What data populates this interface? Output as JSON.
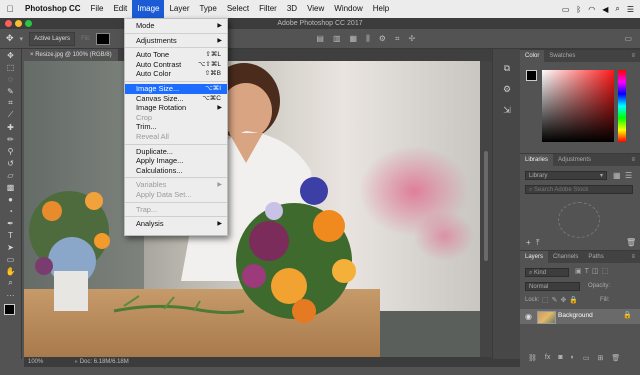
{
  "menubar": {
    "app": "Photoshop CC",
    "items": [
      "File",
      "Edit",
      "Image",
      "Layer",
      "Type",
      "Select",
      "Filter",
      "3D",
      "View",
      "Window",
      "Help"
    ],
    "active": "Image"
  },
  "window_title": "Adobe Photoshop CC 2017",
  "options_bar": {
    "sample_label": "Active Layers",
    "fill_label": "Fill:"
  },
  "document_tab": "Resize.jpg @ 100% (RGB/8)",
  "status": {
    "zoom": "100%",
    "doc": "Doc: 6.18M/6.18M"
  },
  "image_menu": {
    "items": [
      {
        "label": "Mode",
        "submenu": true
      },
      {
        "sep": true
      },
      {
        "label": "Adjustments",
        "submenu": true
      },
      {
        "sep": true
      },
      {
        "label": "Auto Tone",
        "shortcut": "⇧⌘L"
      },
      {
        "label": "Auto Contrast",
        "shortcut": "⌥⇧⌘L"
      },
      {
        "label": "Auto Color",
        "shortcut": "⇧⌘B"
      },
      {
        "sep": true
      },
      {
        "label": "Image Size...",
        "shortcut": "⌥⌘I",
        "selected": true
      },
      {
        "label": "Canvas Size...",
        "shortcut": "⌥⌘C"
      },
      {
        "label": "Image Rotation",
        "submenu": true
      },
      {
        "label": "Crop",
        "disabled": true
      },
      {
        "label": "Trim..."
      },
      {
        "label": "Reveal All",
        "disabled": true
      },
      {
        "sep": true
      },
      {
        "label": "Duplicate..."
      },
      {
        "label": "Apply Image..."
      },
      {
        "label": "Calculations..."
      },
      {
        "sep": true
      },
      {
        "label": "Variables",
        "submenu": true,
        "disabled": true
      },
      {
        "label": "Apply Data Set...",
        "disabled": true
      },
      {
        "sep": true
      },
      {
        "label": "Trap...",
        "disabled": true
      },
      {
        "sep": true
      },
      {
        "label": "Analysis",
        "submenu": true
      }
    ]
  },
  "panels": {
    "color_tabs": [
      "Color",
      "Swatches"
    ],
    "libraries_tabs": [
      "Libraries",
      "Adjustments"
    ],
    "library_select": "Library",
    "library_search": "Search Adobe Stock",
    "layers_tabs": [
      "Layers",
      "Channels",
      "Paths"
    ],
    "layers_kind": "Kind",
    "blend_mode": "Normal",
    "opacity_label": "Opacity:",
    "lock_label": "Lock:",
    "fill_label": "Fill:",
    "layer_name": "Background"
  },
  "colors": {
    "menu_highlight": "#1b6cff",
    "menubar_active": "#1b5bd6",
    "panel_bg": "#535353"
  }
}
